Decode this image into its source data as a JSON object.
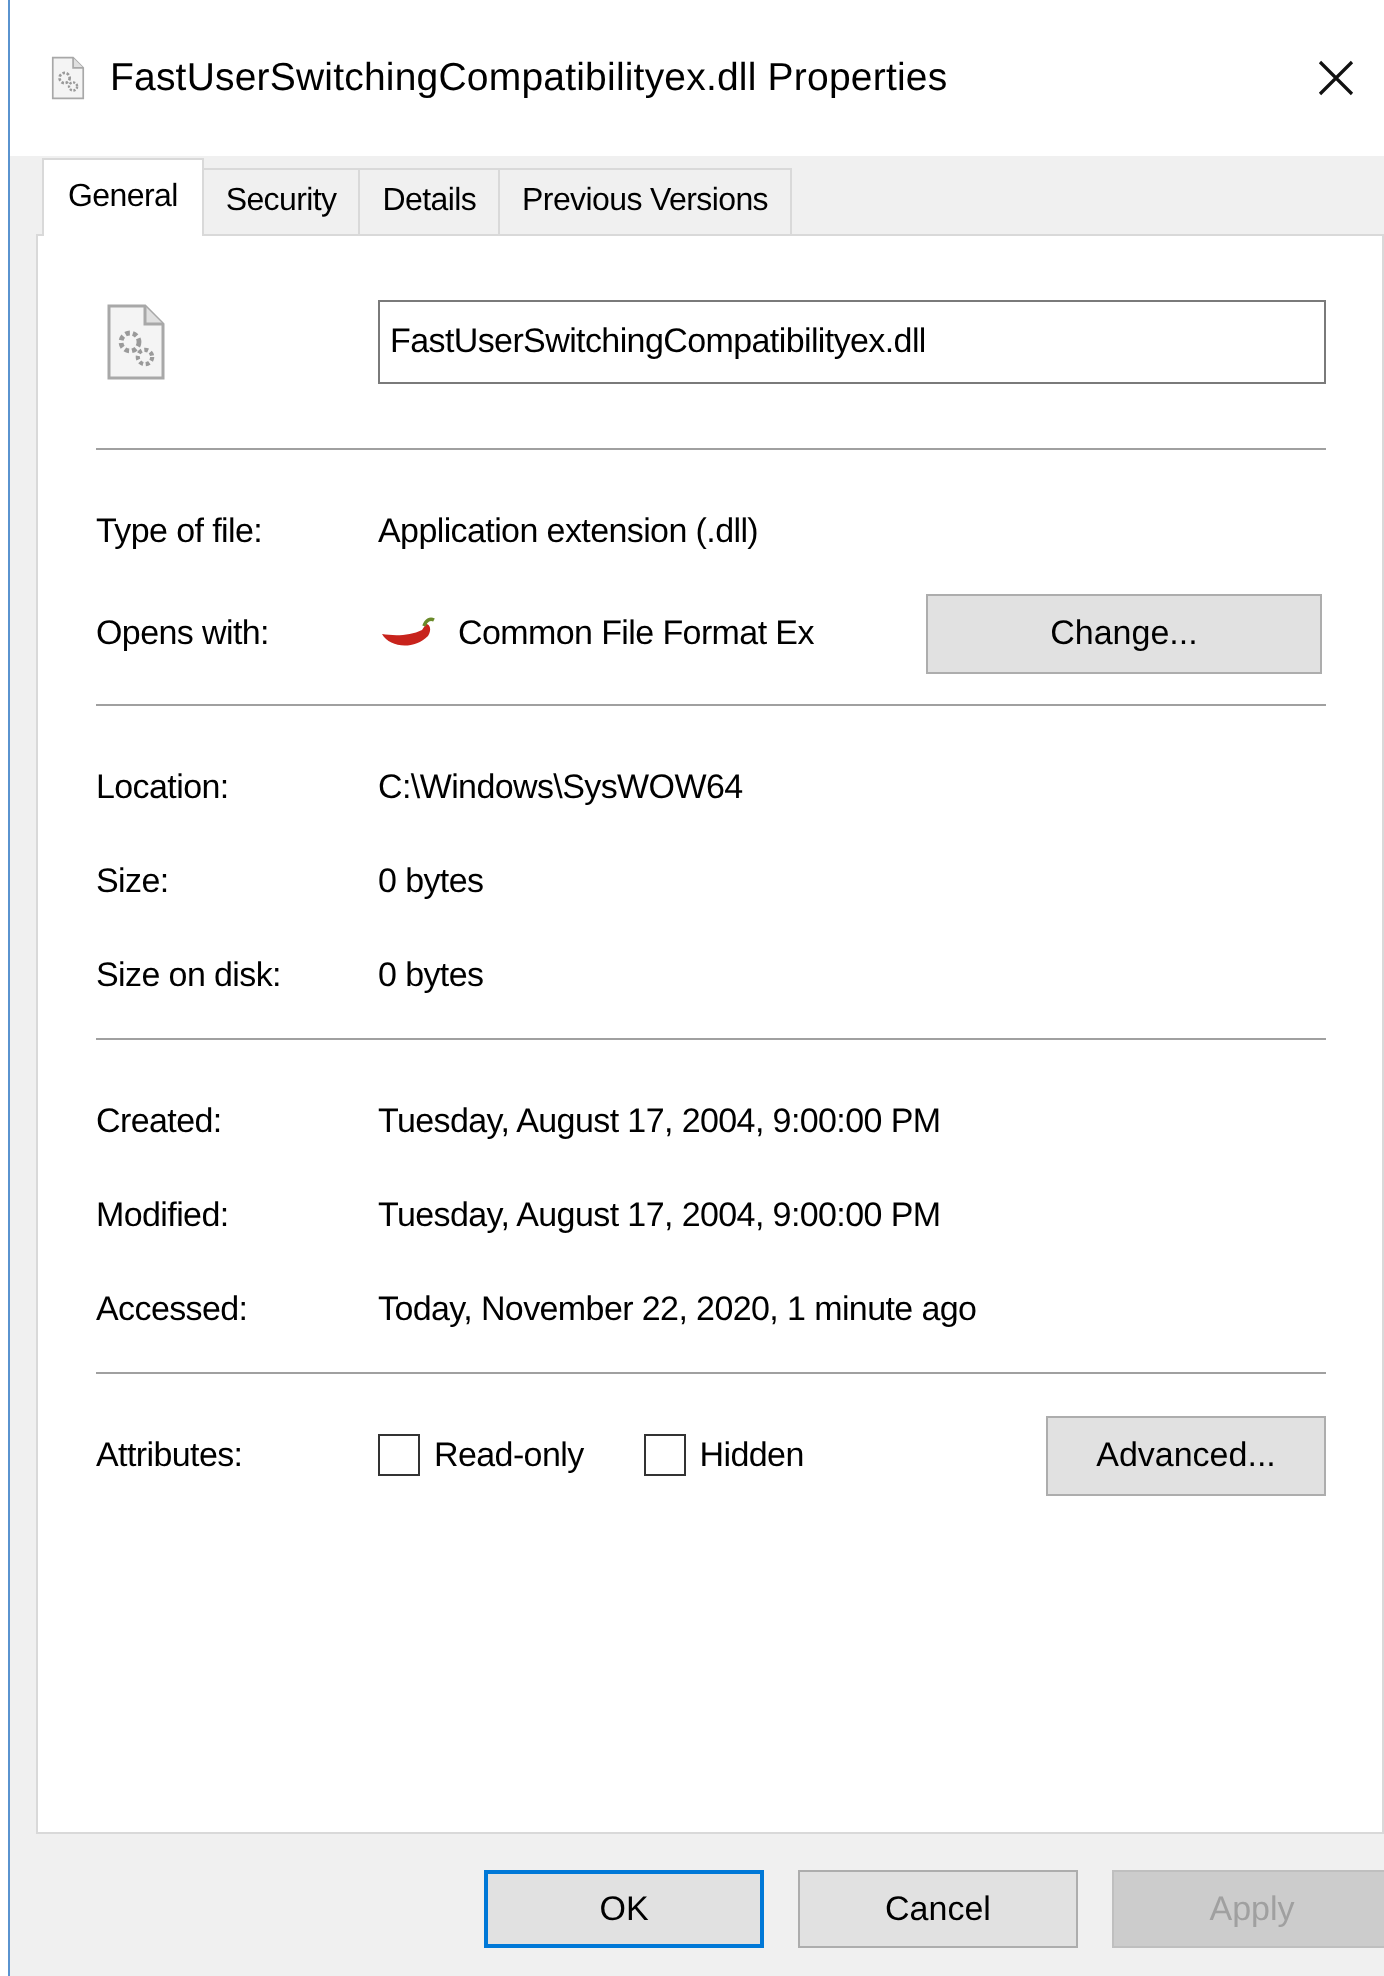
{
  "window": {
    "title": "FastUserSwitchingCompatibilityex.dll Properties"
  },
  "tabs": [
    {
      "label": "General",
      "selected": true
    },
    {
      "label": "Security",
      "selected": false
    },
    {
      "label": "Details",
      "selected": false
    },
    {
      "label": "Previous Versions",
      "selected": false
    }
  ],
  "file_name": {
    "value": "FastUserSwitchingCompatibilityex.dll"
  },
  "sections": [
    [
      {
        "kind": "text",
        "label": "Type of file:",
        "value": "Application extension (.dll)"
      },
      {
        "kind": "app",
        "label": "Opens with:",
        "value": "Common File Format Ex",
        "button": "Change..."
      }
    ],
    [
      {
        "kind": "text",
        "label": "Location:",
        "value": "C:\\Windows\\SysWOW64"
      },
      {
        "kind": "text",
        "label": "Size:",
        "value": "0 bytes"
      },
      {
        "kind": "text",
        "label": "Size on disk:",
        "value": "0 bytes"
      }
    ],
    [
      {
        "kind": "text",
        "label": "Created:",
        "value": "Tuesday, August 17, 2004, 9:00:00 PM"
      },
      {
        "kind": "text",
        "label": "Modified:",
        "value": "Tuesday, August 17, 2004, 9:00:00 PM"
      },
      {
        "kind": "text",
        "label": "Accessed:",
        "value": "Today, November 22, 2020, 1 minute ago"
      }
    ]
  ],
  "attributes": {
    "label": "Attributes:",
    "options": [
      {
        "label": "Read-only",
        "checked": false
      },
      {
        "label": "Hidden",
        "checked": false
      }
    ],
    "button": "Advanced..."
  },
  "buttons": [
    {
      "label": "OK",
      "default": true,
      "disabled": false
    },
    {
      "label": "Cancel",
      "default": false,
      "disabled": false
    },
    {
      "label": "Apply",
      "default": false,
      "disabled": true
    }
  ]
}
